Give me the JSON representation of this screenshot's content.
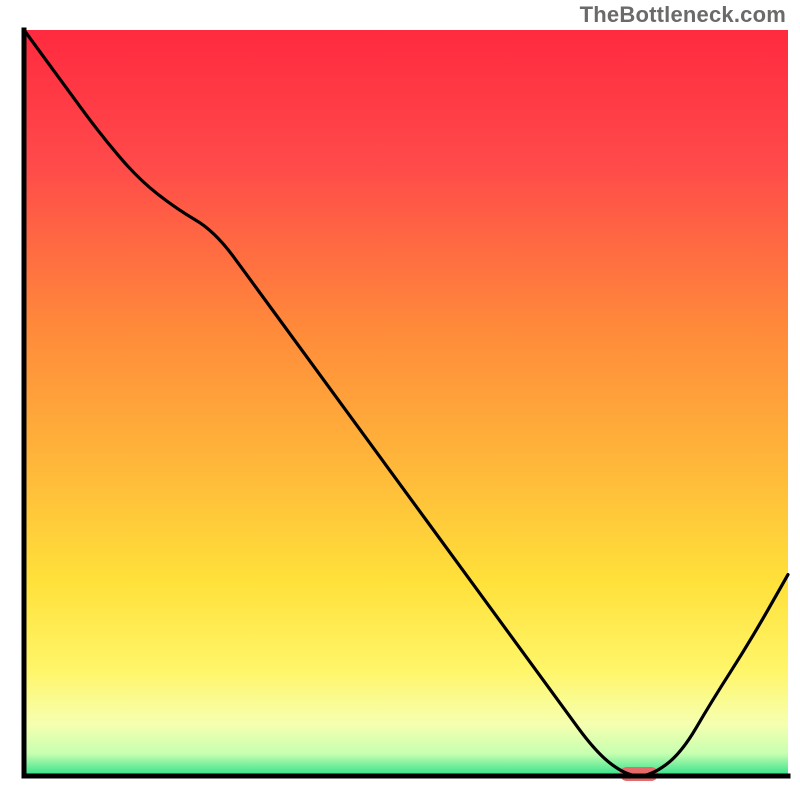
{
  "watermark": "TheBottleneck.com",
  "chart_data": {
    "type": "line",
    "title": "",
    "xlabel": "",
    "ylabel": "",
    "xlim": [
      0,
      100
    ],
    "ylim": [
      0,
      100
    ],
    "grid": false,
    "legend": false,
    "series": [
      {
        "name": "bottleneck-curve",
        "x": [
          0,
          5,
          10,
          15,
          20,
          25,
          30,
          35,
          40,
          45,
          50,
          55,
          60,
          65,
          70,
          75,
          79,
          82,
          86,
          90,
          95,
          100
        ],
        "y": [
          100,
          93,
          86,
          80,
          76,
          73,
          66,
          59,
          52,
          45,
          38,
          31,
          24,
          17,
          10,
          3,
          0,
          0,
          3,
          10,
          18,
          27
        ]
      }
    ],
    "marker": {
      "name": "optimal-zone",
      "x_start": 78,
      "x_end": 83,
      "y": 0,
      "color": "#e66a6a"
    },
    "background_gradient": {
      "stops": [
        {
          "offset": 0.0,
          "color": "#ff2a3f"
        },
        {
          "offset": 0.18,
          "color": "#ff4a4a"
        },
        {
          "offset": 0.4,
          "color": "#ff8a3a"
        },
        {
          "offset": 0.58,
          "color": "#ffb63a"
        },
        {
          "offset": 0.74,
          "color": "#ffe13a"
        },
        {
          "offset": 0.86,
          "color": "#fff66a"
        },
        {
          "offset": 0.93,
          "color": "#f6ffb0"
        },
        {
          "offset": 0.97,
          "color": "#c7ffb0"
        },
        {
          "offset": 1.0,
          "color": "#2fe08a"
        }
      ]
    },
    "axes": {
      "color": "#000000",
      "width": 5
    }
  }
}
